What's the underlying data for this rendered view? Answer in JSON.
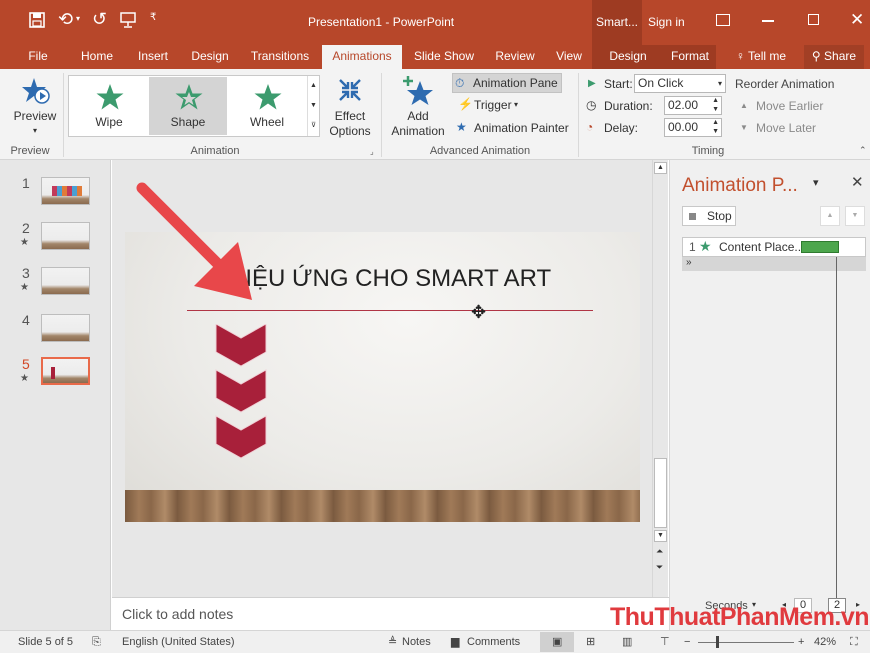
{
  "titlebar": {
    "title": "Presentation1 - PowerPoint",
    "context_label": "Smart...",
    "sign_in": "Sign in",
    "qat_undo": "⟲",
    "qat_redo": "↺"
  },
  "tabs": [
    "File",
    "Home",
    "Insert",
    "Design",
    "Transitions",
    "Animations",
    "Slide Show",
    "Review",
    "View",
    "Design",
    "Format"
  ],
  "tell_me": "Tell me",
  "share": "Share",
  "ribbon": {
    "preview": {
      "label": "Preview",
      "group": "Preview"
    },
    "animation_group": "Animation",
    "animations": [
      "Wipe",
      "Shape",
      "Wheel"
    ],
    "effect_options": [
      "Effect",
      "Options"
    ],
    "add_animation": [
      "Add",
      "Animation"
    ],
    "animation_pane": "Animation Pane",
    "trigger": "Trigger",
    "animation_painter": "Animation Painter",
    "advanced_group": "Advanced Animation",
    "start_label": "Start:",
    "start_value": "On Click",
    "duration_label": "Duration:",
    "duration_value": "02.00",
    "delay_label": "Delay:",
    "delay_value": "00.00",
    "timing_group": "Timing",
    "reorder": "Reorder Animation",
    "move_earlier": "Move Earlier",
    "move_later": "Move Later"
  },
  "slides": [
    {
      "num": "1",
      "star": ""
    },
    {
      "num": "2",
      "star": "★"
    },
    {
      "num": "3",
      "star": "★"
    },
    {
      "num": "4",
      "star": ""
    },
    {
      "num": "5",
      "star": "★"
    }
  ],
  "slide": {
    "title": "HIỆU ỨNG CHO SMART ART"
  },
  "notes_placeholder": "Click to add notes",
  "pane": {
    "title": "Animation P...",
    "stop": "Stop",
    "item_num": "1",
    "item_label": "Content Place...",
    "seconds": "Seconds",
    "tick_0": "0",
    "tick_2": "2"
  },
  "status": {
    "slide_of": "Slide 5 of 5",
    "language": "English (United States)",
    "notes": "Notes",
    "comments": "Comments",
    "zoom": "42%"
  },
  "watermark": "ThuThuatPhanMem.vn",
  "colors": {
    "accent": "#b7472a",
    "star": "#3c9b6e",
    "bar": "#4ca64c",
    "chevron": "#a8203a",
    "arrow": "#e8474a"
  }
}
